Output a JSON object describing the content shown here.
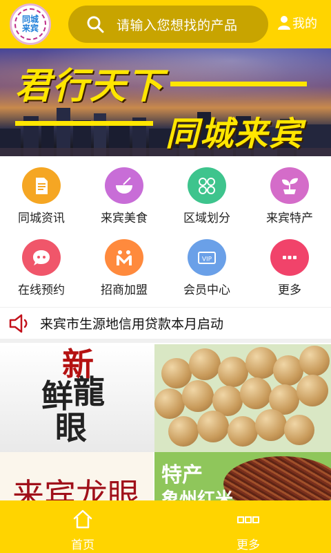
{
  "header": {
    "logo_text": [
      "同城",
      "来宾"
    ],
    "search_placeholder": "请输入您想找的产品",
    "mine_label": "我的"
  },
  "banner": {
    "title1": "君行天下",
    "title2": "同城来宾"
  },
  "grid": [
    {
      "label": "同城资讯",
      "icon": "document-icon",
      "color": "#f5a623"
    },
    {
      "label": "来宾美食",
      "icon": "bowl-icon",
      "color": "#c86dd7"
    },
    {
      "label": "区域划分",
      "icon": "clover-icon",
      "color": "#3ec48d"
    },
    {
      "label": "来宾特产",
      "icon": "sprout-icon",
      "color": "#d46cc9"
    },
    {
      "label": "在线预约",
      "icon": "chat-icon",
      "color": "#f0566a"
    },
    {
      "label": "招商加盟",
      "icon": "people-icon",
      "color": "#ff8a3d"
    },
    {
      "label": "会员中心",
      "icon": "vip-icon",
      "color": "#6aa0e8"
    },
    {
      "label": "更多",
      "icon": "more-icon",
      "color": "#f1436a"
    }
  ],
  "vip_badge": "VIP",
  "notice": {
    "text": "来宾市生源地信用贷款本月启动"
  },
  "promo": {
    "calligraphy": [
      "新",
      "鲜",
      "龍",
      "眼"
    ]
  },
  "cards": {
    "left_title": "来宾龙眼",
    "right_title": "特产",
    "right_sub": "象州红米"
  },
  "tabbar": {
    "home_label": "首页",
    "more_label": "更多"
  },
  "colors": {
    "brand_yellow": "#ffd400",
    "search_bg": "#c8a400"
  }
}
